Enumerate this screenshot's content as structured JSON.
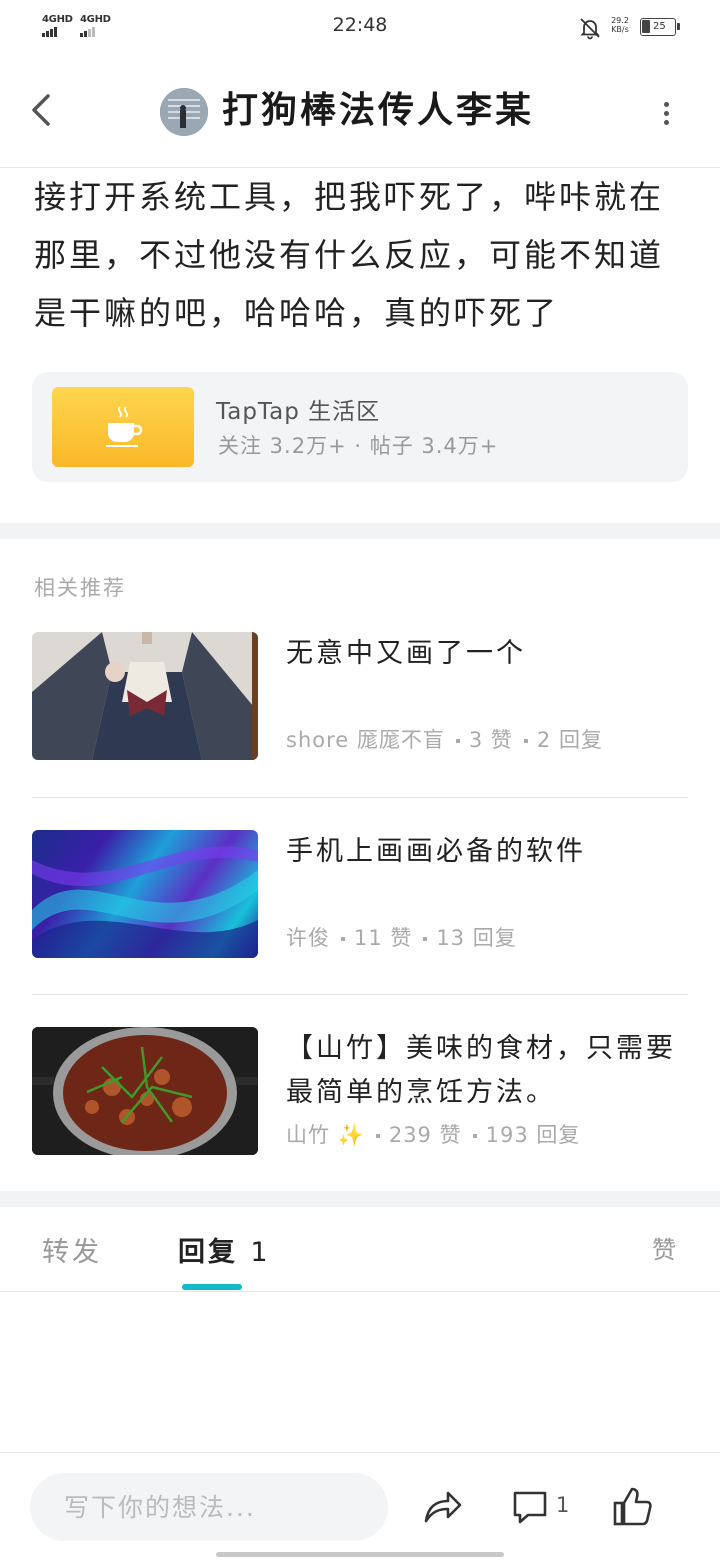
{
  "status_bar": {
    "signal_1": "4GHD",
    "signal_2": "4GHD",
    "time": "22:48",
    "net_speed_value": "29.2",
    "net_speed_unit": "KB/s",
    "battery": "25"
  },
  "header": {
    "title": "打狗棒法传人李某"
  },
  "post": {
    "body": "接打开系统工具，把我吓死了，哔咔就在那里，不过他没有什么反应，可能不知道是干嘛的吧，哈哈哈，真的吓死了"
  },
  "forum": {
    "name": "TapTap 生活区",
    "stats": "关注 3.2万+ · 帖子 3.4万+"
  },
  "recommend": {
    "header": "相关推荐",
    "items": [
      {
        "title": "无意中又画了一个",
        "author": "shore 厖厖不盲",
        "likes": "3 赞",
        "replies": "2 回复"
      },
      {
        "title": "手机上画画必备的软件",
        "author": "许俊",
        "likes": "11 赞",
        "replies": "13 回复"
      },
      {
        "title": "【山竹】美味的食材，只需要最简单的烹饪方法。",
        "author": "山竹 ✨",
        "likes": "239 赞",
        "replies": "193 回复"
      }
    ]
  },
  "tabs": {
    "repost": "转发",
    "reply": "回复",
    "reply_count": "1",
    "like": "赞"
  },
  "bottom_bar": {
    "placeholder": "写下你的想法...",
    "reply_count": "1"
  },
  "colors": {
    "accent": "#15b8c8",
    "forum_icon": "#fbb829"
  }
}
